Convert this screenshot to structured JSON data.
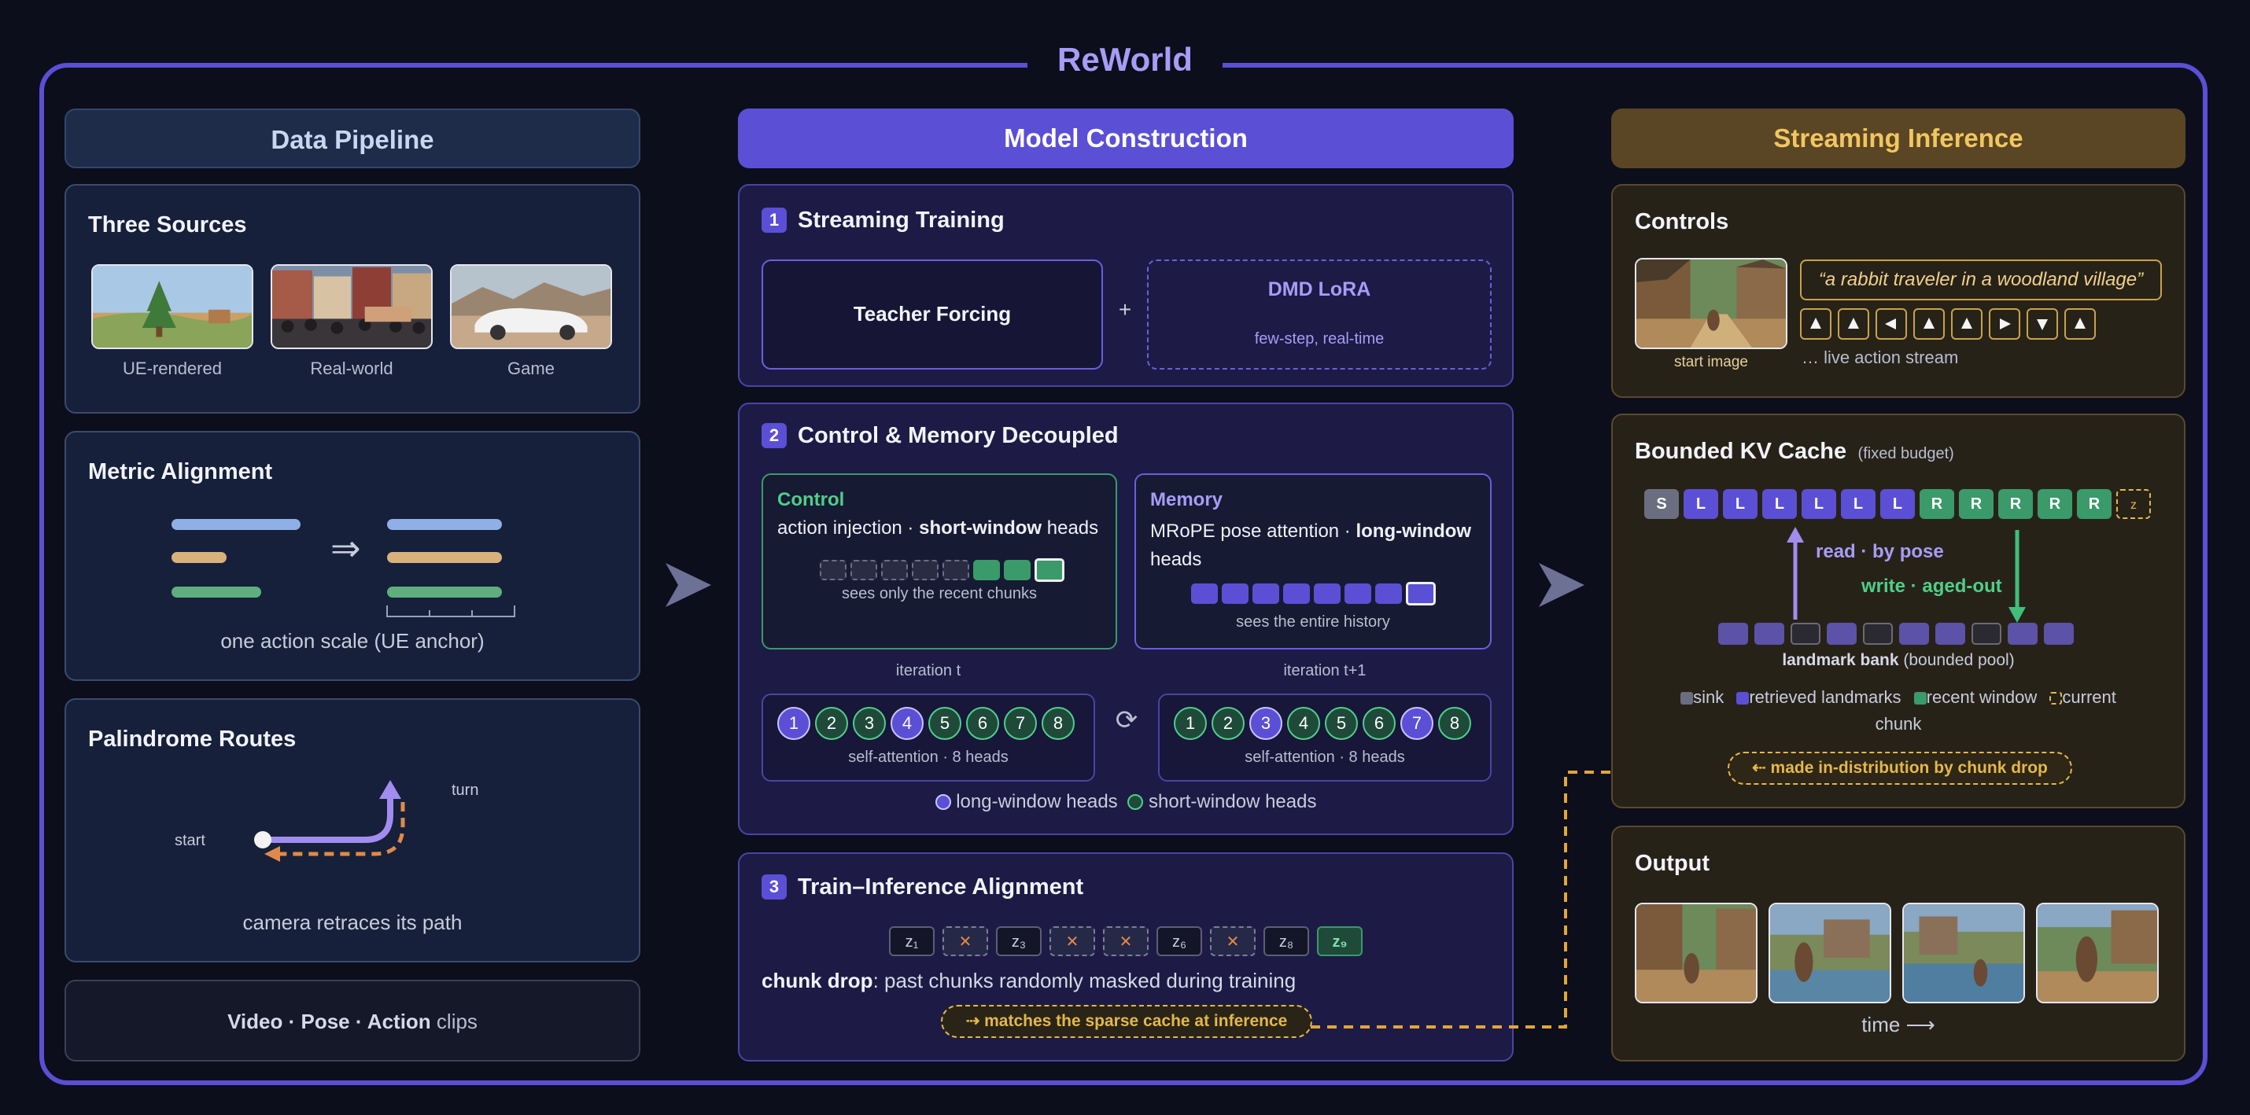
{
  "title": "ReWorld",
  "columns": {
    "left": "Data Pipeline",
    "middle": "Model Construction",
    "right": "Streaming Inference"
  },
  "three_sources": {
    "title": "Three Sources",
    "items": [
      "UE-rendered",
      "Real-world",
      "Game"
    ]
  },
  "metric_alignment": {
    "title": "Metric Alignment",
    "arrow": "⇒",
    "caption": "one action scale (UE anchor)"
  },
  "palindrome": {
    "title": "Palindrome Routes",
    "start": "start",
    "turn": "turn",
    "caption": "camera retraces its path"
  },
  "clips": {
    "video": "Video",
    "dot1": " · ",
    "pose": "Pose",
    "dot2": " · ",
    "action": "Action",
    "suffix": " clips"
  },
  "streaming_training": {
    "num": "1",
    "title": "Streaming Training",
    "teacher": "Teacher Forcing",
    "plus": "+",
    "dmd_title": "DMD LoRA",
    "dmd_sub": "few-step, real-time"
  },
  "decoupled": {
    "num": "2",
    "title": "Control & Memory Decoupled",
    "control": {
      "label": "Control",
      "desc_a": "action injection · ",
      "desc_b": "short-window",
      "desc_c": " heads",
      "caption": "sees only the recent chunks"
    },
    "memory": {
      "label": "Memory",
      "desc_a": "MRoPE pose attention · ",
      "desc_b": "long-window",
      "desc_c": "heads",
      "caption": "sees the entire history"
    },
    "iter_t": "iteration t",
    "iter_t1": "iteration t+1",
    "cycle": "⟳",
    "heads_t": [
      "1",
      "2",
      "3",
      "4",
      "5",
      "6",
      "7",
      "8"
    ],
    "heads_t1": [
      "1",
      "2",
      "3",
      "4",
      "5",
      "6",
      "7",
      "8"
    ],
    "long_t": [
      1,
      4
    ],
    "long_t1": [
      3,
      7
    ],
    "attn_caption": "self-attention · 8 heads",
    "legend_long": "long-window heads",
    "legend_short": "short-window heads"
  },
  "alignment": {
    "num": "3",
    "title": "Train–Inference Alignment",
    "tokens": [
      "z₁",
      "✕",
      "z₃",
      "✕",
      "✕",
      "z₆",
      "✕",
      "z₈",
      "z₉"
    ],
    "chunk_drop": "chunk drop",
    "desc": ": past chunks randomly masked during training",
    "callout": "⇢ matches the sparse cache at inference"
  },
  "controls": {
    "title": "Controls",
    "start_image": "start image",
    "prompt": "“a rabbit traveler in a woodland village”",
    "actions": [
      "up",
      "up",
      "left",
      "up",
      "up",
      "right",
      "down",
      "up"
    ],
    "stream": "… live action stream"
  },
  "kv_cache": {
    "title": "Bounded KV Cache",
    "subtitle": "(fixed budget)",
    "tokens": [
      "S",
      "L",
      "L",
      "L",
      "L",
      "L",
      "L",
      "R",
      "R",
      "R",
      "R",
      "R",
      "z"
    ],
    "read": "read · by pose",
    "write": "write · aged-out",
    "bank_label": "landmark bank",
    "bank_suffix": " (bounded pool)",
    "legend": [
      "sink",
      "retrieved landmarks",
      "recent window",
      "current"
    ],
    "legend_chunk": "chunk",
    "callout": "⇠ made in-distribution by chunk drop"
  },
  "output": {
    "title": "Output",
    "time": "time ⟶"
  },
  "colors": {
    "accent": "#5b4fd6",
    "green": "#3a9a6a",
    "orange": "#e08a4a",
    "gold": "#e3b84a",
    "blue": "#8fb0e6",
    "tan": "#d8b27a"
  }
}
